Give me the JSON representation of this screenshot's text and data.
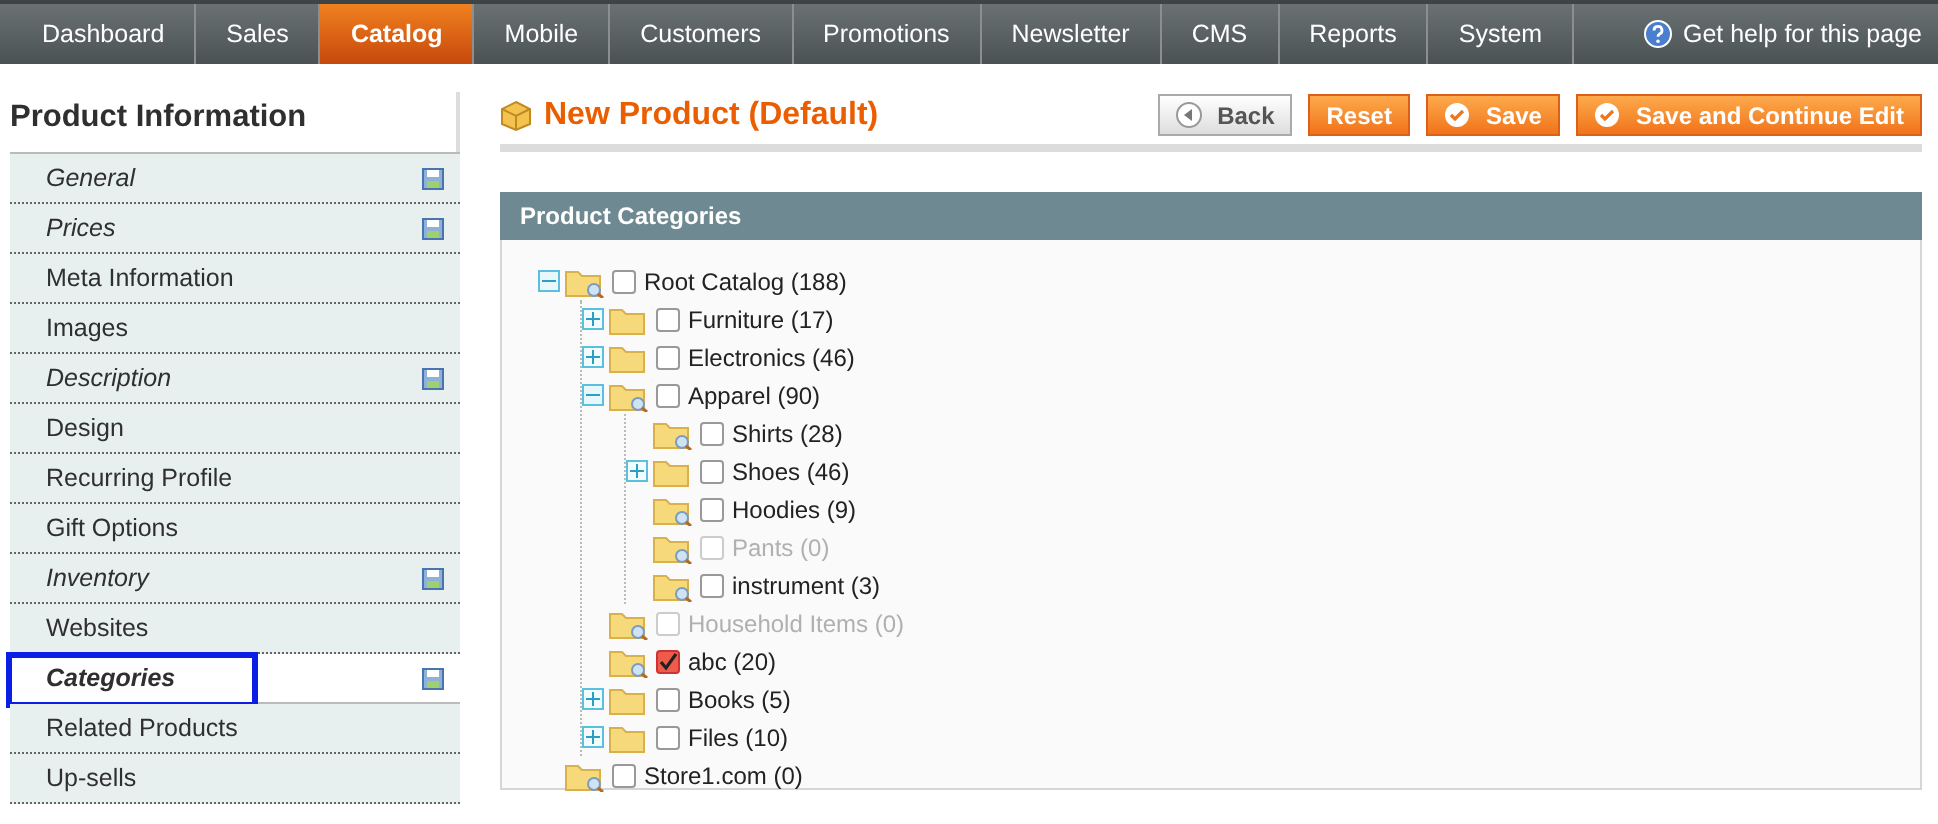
{
  "nav": {
    "tabs": [
      {
        "label": "Dashboard",
        "selected": false
      },
      {
        "label": "Sales",
        "selected": false
      },
      {
        "label": "Catalog",
        "selected": true
      },
      {
        "label": "Mobile",
        "selected": false
      },
      {
        "label": "Customers",
        "selected": false
      },
      {
        "label": "Promotions",
        "selected": false
      },
      {
        "label": "Newsletter",
        "selected": false
      },
      {
        "label": "CMS",
        "selected": false
      },
      {
        "label": "Reports",
        "selected": false
      },
      {
        "label": "System",
        "selected": false
      }
    ],
    "help": "Get help for this page"
  },
  "sidebar": {
    "title": "Product Information",
    "items": [
      {
        "label": "General",
        "changed": true,
        "selected": false,
        "highlighted": false
      },
      {
        "label": "Prices",
        "changed": true,
        "selected": false,
        "highlighted": false
      },
      {
        "label": "Meta Information",
        "changed": false,
        "selected": false,
        "highlighted": false
      },
      {
        "label": "Images",
        "changed": false,
        "selected": false,
        "highlighted": false
      },
      {
        "label": "Description",
        "changed": true,
        "selected": false,
        "highlighted": false
      },
      {
        "label": "Design",
        "changed": false,
        "selected": false,
        "highlighted": false
      },
      {
        "label": "Recurring Profile",
        "changed": false,
        "selected": false,
        "highlighted": false
      },
      {
        "label": "Gift Options",
        "changed": false,
        "selected": false,
        "highlighted": false
      },
      {
        "label": "Inventory",
        "changed": true,
        "selected": false,
        "highlighted": false
      },
      {
        "label": "Websites",
        "changed": false,
        "selected": false,
        "highlighted": false
      },
      {
        "label": "Categories",
        "changed": true,
        "selected": true,
        "highlighted": true
      },
      {
        "label": "Related Products",
        "changed": false,
        "selected": false,
        "highlighted": false
      },
      {
        "label": "Up-sells",
        "changed": false,
        "selected": false,
        "highlighted": false
      }
    ]
  },
  "page": {
    "title": "New Product (Default)",
    "buttons": [
      {
        "label": "Back",
        "kind": "back"
      },
      {
        "label": "Reset",
        "kind": "plain"
      },
      {
        "label": "Save",
        "kind": "save"
      },
      {
        "label": "Save and Continue Edit",
        "kind": "save"
      }
    ]
  },
  "panel": {
    "title": "Product Categories",
    "tree": [
      {
        "label": "Root Catalog (188)",
        "kind": "branch",
        "expanded": true,
        "checked": false,
        "disabled": false,
        "children": [
          {
            "label": "Furniture (17)",
            "kind": "branch",
            "expanded": false,
            "checked": false,
            "disabled": false
          },
          {
            "label": "Electronics (46)",
            "kind": "branch",
            "expanded": false,
            "checked": false,
            "disabled": false
          },
          {
            "label": "Apparel (90)",
            "kind": "branch",
            "expanded": true,
            "checked": false,
            "disabled": false,
            "children": [
              {
                "label": "Shirts (28)",
                "kind": "leaf",
                "checked": false,
                "disabled": false
              },
              {
                "label": "Shoes (46)",
                "kind": "branch",
                "expanded": false,
                "checked": false,
                "disabled": false
              },
              {
                "label": "Hoodies (9)",
                "kind": "leaf",
                "checked": false,
                "disabled": false
              },
              {
                "label": "Pants (0)",
                "kind": "leaf",
                "checked": false,
                "disabled": true
              },
              {
                "label": "instrument (3)",
                "kind": "leaf",
                "checked": false,
                "disabled": false
              }
            ]
          },
          {
            "label": "Household Items (0)",
            "kind": "leaf",
            "checked": false,
            "disabled": true
          },
          {
            "label": "abc (20)",
            "kind": "leaf",
            "checked": true,
            "disabled": false
          },
          {
            "label": "Books (5)",
            "kind": "branch",
            "expanded": false,
            "checked": false,
            "disabled": false
          },
          {
            "label": "Files (10)",
            "kind": "branch",
            "expanded": false,
            "checked": false,
            "disabled": false
          }
        ]
      },
      {
        "label": "Store1.com (0)",
        "kind": "leaf",
        "checked": false,
        "disabled": false
      }
    ]
  }
}
